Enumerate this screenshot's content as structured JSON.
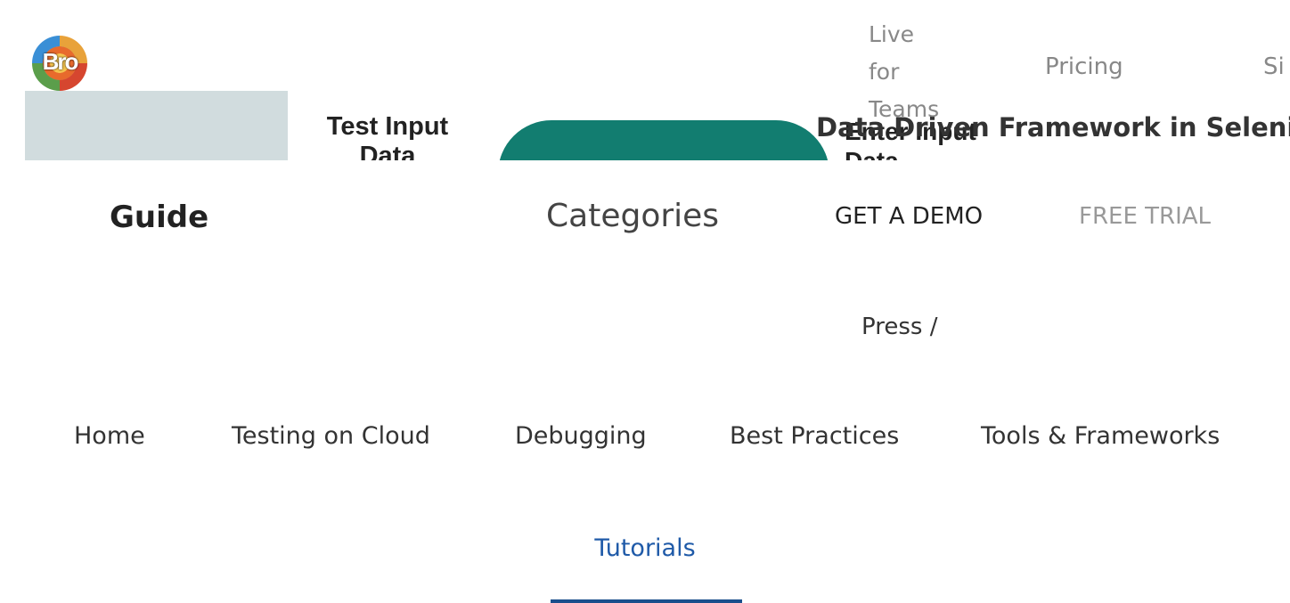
{
  "logo": {
    "text": "Bro"
  },
  "diagram": {
    "label_left": "Test Input Data",
    "label_right": "Enter Input Data"
  },
  "article_title": "Data Driven Framework in Selenium",
  "top_nav": {
    "live": "Live for Teams",
    "pricing": "Pricing",
    "signin": "Si"
  },
  "header": {
    "guide": "Guide",
    "categories": "Categories",
    "demo": "GET A DEMO",
    "trial": "FREE TRIAL"
  },
  "search": {
    "hint": "Press /"
  },
  "tabs": [
    {
      "label": "Home"
    },
    {
      "label": "Testing on Cloud"
    },
    {
      "label": "Debugging"
    },
    {
      "label": "Best Practices"
    },
    {
      "label": "Tools & Frameworks"
    },
    {
      "label": "Tutorials",
      "active": true
    }
  ],
  "colors": {
    "active_tab": "#1f5aa8",
    "underline": "#1a4f8c",
    "diagram_bg": "#d1dcde",
    "diagram_pill": "#127d70"
  }
}
